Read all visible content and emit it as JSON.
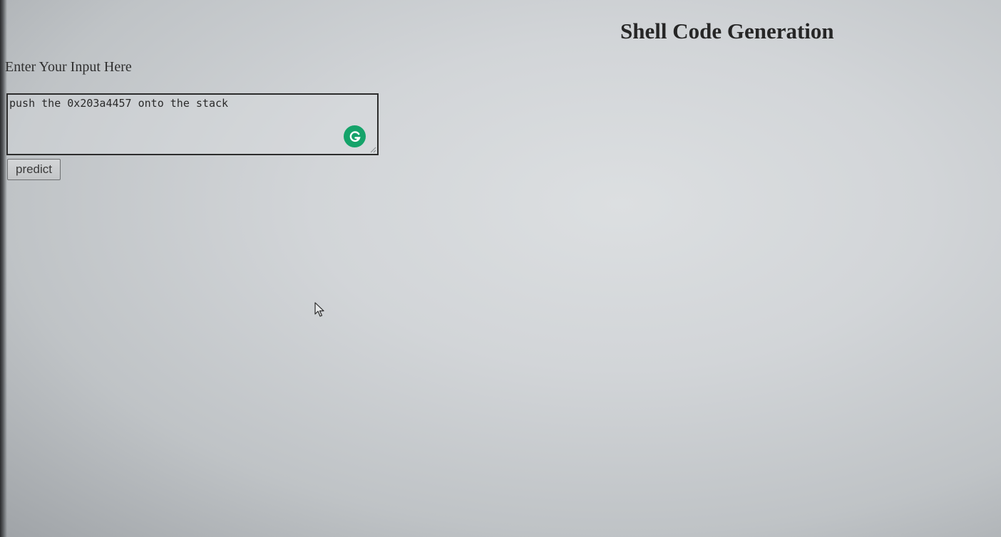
{
  "header": {
    "title": "Shell Code Generation"
  },
  "form": {
    "label": "Enter Your Input Here",
    "input_value": "push the 0x203a4457 onto the stack",
    "predict_label": "predict"
  },
  "icons": {
    "grammarly": "grammarly-icon",
    "cursor": "mouse-cursor-icon"
  },
  "colors": {
    "grammarly_green": "#15a36a",
    "background": "#d2d5d8"
  }
}
